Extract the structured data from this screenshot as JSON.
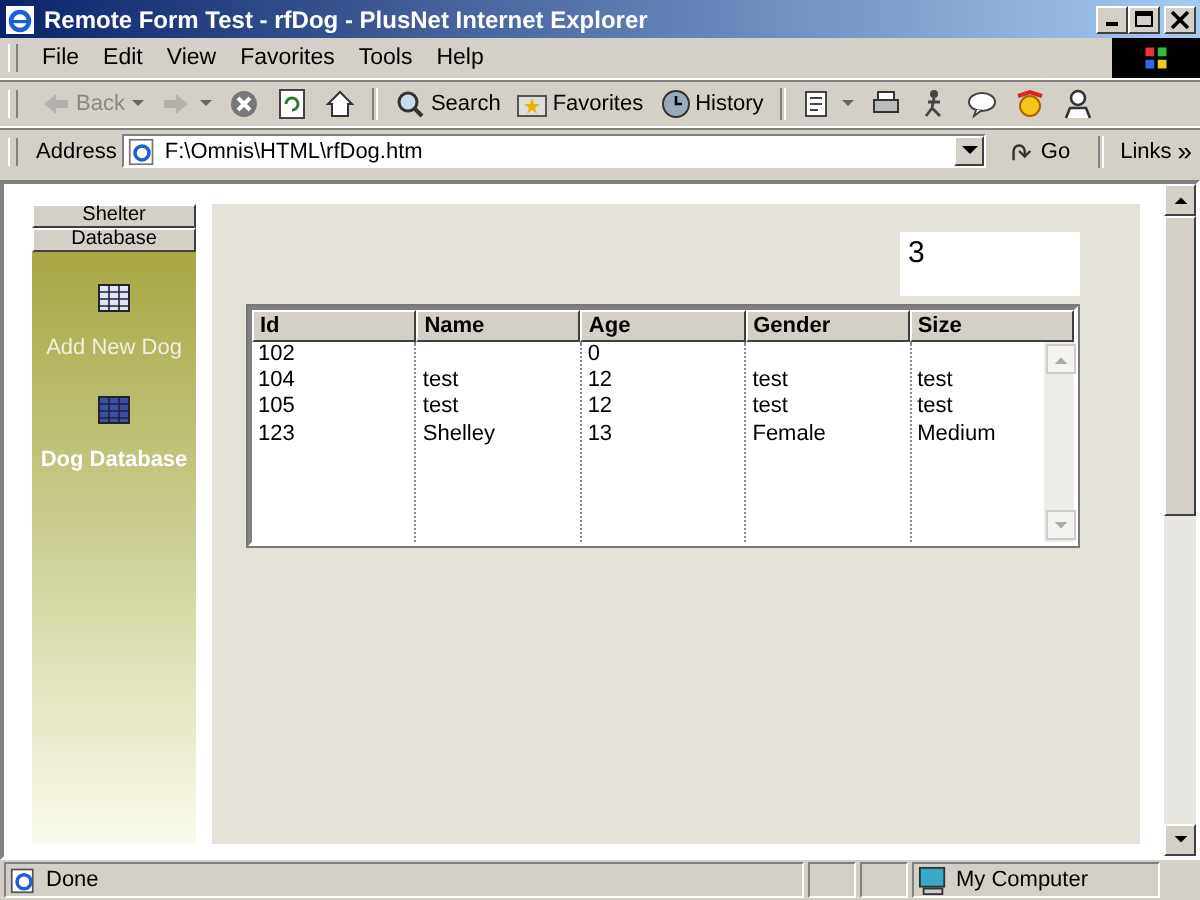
{
  "window": {
    "title": "Remote Form Test - rfDog - PlusNet Internet Explorer"
  },
  "menu": [
    "File",
    "Edit",
    "View",
    "Favorites",
    "Tools",
    "Help"
  ],
  "toolbar": [
    {
      "kind": "back",
      "label": "Back",
      "disabled": true
    },
    {
      "kind": "forward",
      "disabled": true
    },
    {
      "kind": "stop",
      "disabled": false
    },
    {
      "kind": "refresh",
      "disabled": false
    },
    {
      "kind": "home",
      "disabled": false
    },
    {
      "kind": "search",
      "label": "Search",
      "disabled": false
    },
    {
      "kind": "favorites",
      "label": "Favorites",
      "disabled": false
    },
    {
      "kind": "history",
      "label": "History",
      "disabled": false
    },
    {
      "kind": "edit",
      "disabled": false
    },
    {
      "kind": "print",
      "disabled": false
    },
    {
      "kind": "person",
      "disabled": false
    },
    {
      "kind": "discuss",
      "disabled": false
    },
    {
      "kind": "messenger",
      "disabled": false
    },
    {
      "kind": "contact",
      "disabled": false
    }
  ],
  "address": {
    "label": "Address",
    "value": "F:\\Omnis\\HTML\\rfDog.htm",
    "go": "Go",
    "links": "Links",
    "more": "»"
  },
  "sidebar": {
    "tabs": [
      "Shelter",
      "Database"
    ],
    "items": [
      {
        "label": "Add New Dog",
        "selected": false
      },
      {
        "label": "Dog Database",
        "selected": true
      }
    ]
  },
  "count_field": {
    "value": "3"
  },
  "table": {
    "columns": [
      "Id",
      "Name",
      "Age",
      "Gender",
      "Size"
    ],
    "rows": [
      [
        "102",
        "",
        "0",
        "",
        ""
      ],
      [
        "104",
        "test",
        "12",
        "test",
        "test"
      ],
      [
        "105",
        "test",
        "12",
        "test",
        "test"
      ],
      [
        "123",
        "Shelley",
        "13",
        "Female",
        "Medium"
      ]
    ]
  },
  "status_bar": {
    "text": "Done",
    "zone": "My Computer"
  }
}
